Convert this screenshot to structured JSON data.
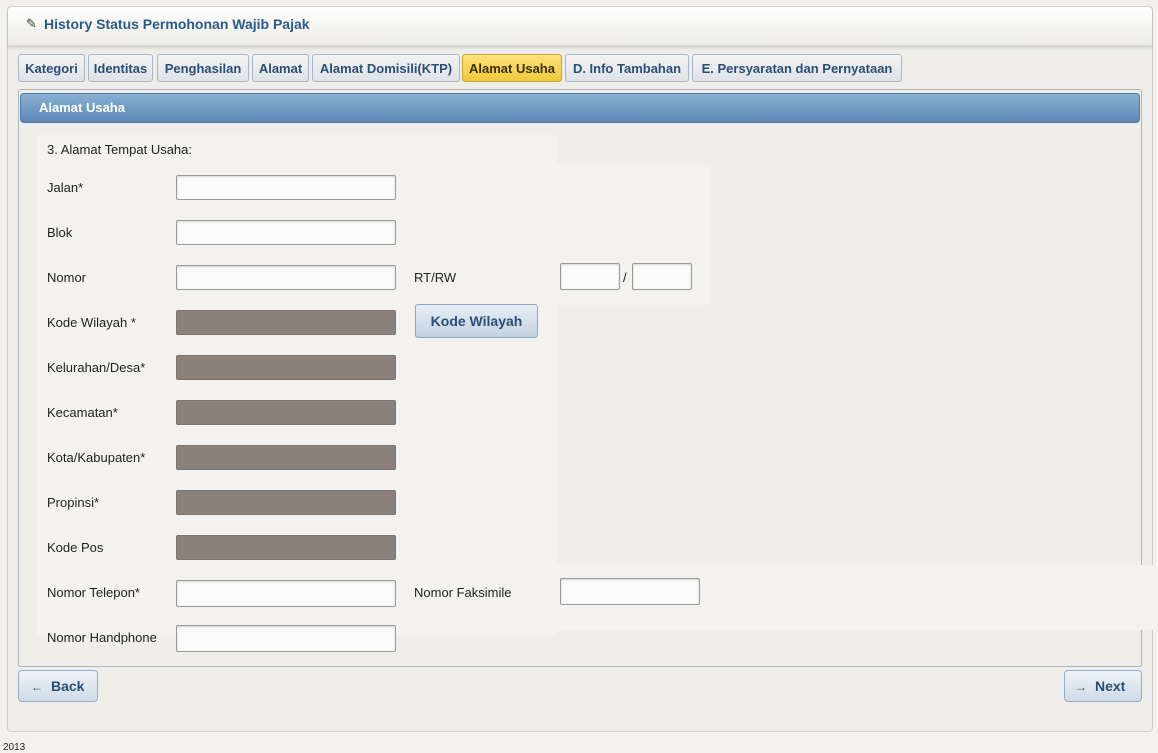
{
  "window": {
    "title": "History Status Permohonan Wajib Pajak",
    "title_icon": "edit-icon"
  },
  "tabs": [
    {
      "label": "Kategori",
      "active": false
    },
    {
      "label": "Identitas",
      "active": false
    },
    {
      "label": "Penghasilan",
      "active": false
    },
    {
      "label": "Alamat",
      "active": false
    },
    {
      "label": "Alamat Domisili(KTP)",
      "active": false
    },
    {
      "label": "Alamat Usaha",
      "active": true
    },
    {
      "label": "D. Info Tambahan",
      "active": false
    },
    {
      "label": "E. Persyaratan dan Pernyataan",
      "active": false
    }
  ],
  "panel": {
    "header": "Alamat Usaha",
    "section_title": "3. Alamat Tempat Usaha:"
  },
  "form": {
    "jalan": {
      "label": "Jalan*",
      "value": ""
    },
    "blok": {
      "label": "Blok",
      "value": ""
    },
    "nomor": {
      "label": "Nomor",
      "value": ""
    },
    "rtrw": {
      "label": "RT/RW",
      "rt": "",
      "rw": "",
      "separator": "/"
    },
    "kode_wilayah": {
      "label": "Kode Wilayah *",
      "value": "",
      "button": "Kode Wilayah"
    },
    "kelurahan": {
      "label": "Kelurahan/Desa*",
      "value": ""
    },
    "kecamatan": {
      "label": "Kecamatan*",
      "value": ""
    },
    "kota": {
      "label": "Kota/Kabupaten*",
      "value": ""
    },
    "propinsi": {
      "label": "Propinsi*",
      "value": ""
    },
    "kode_pos": {
      "label": "Kode Pos",
      "value": ""
    },
    "telepon": {
      "label": "Nomor Telepon*",
      "value": ""
    },
    "faksimile": {
      "label": "Nomor Faksimile",
      "value": ""
    },
    "handphone": {
      "label": "Nomor Handphone",
      "value": ""
    }
  },
  "nav": {
    "back": "Back",
    "next": "Next",
    "back_icon": "arrow-left-icon",
    "next_icon": "arrow-right-icon"
  },
  "footer": {
    "text": "2013"
  },
  "colors": {
    "active_tab": "#f1c93b",
    "header_blue": "#5b88b6",
    "disabled_field": "#8c827c",
    "title_text": "#2b5a8a"
  }
}
